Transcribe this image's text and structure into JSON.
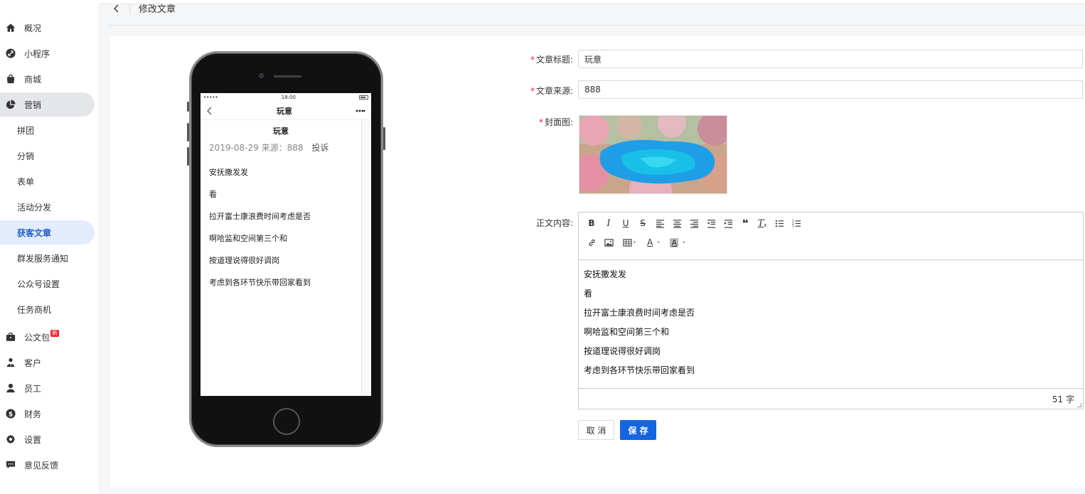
{
  "sidebar": {
    "items": [
      {
        "label": "概况",
        "icon": "home-icon"
      },
      {
        "label": "小程序",
        "icon": "link-icon"
      },
      {
        "label": "商城",
        "icon": "shopping-bag-icon"
      },
      {
        "label": "营销",
        "icon": "pie-chart-icon"
      },
      {
        "label": "拼团"
      },
      {
        "label": "分销"
      },
      {
        "label": "表单"
      },
      {
        "label": "活动分发"
      },
      {
        "label": "获客文章"
      },
      {
        "label": "群发服务通知"
      },
      {
        "label": "公众号设置"
      },
      {
        "label": "任务商机"
      },
      {
        "label": "公文包",
        "icon": "briefcase-icon",
        "badge": "新"
      },
      {
        "label": "客户",
        "icon": "customers-icon"
      },
      {
        "label": "员工",
        "icon": "user-icon"
      },
      {
        "label": "财务",
        "icon": "dollar-icon"
      },
      {
        "label": "设置",
        "icon": "gear-icon"
      },
      {
        "label": "意见反馈",
        "icon": "feedback-icon"
      }
    ],
    "active_item": "获客文章",
    "active_group": "营销"
  },
  "header": {
    "title": "修改文章"
  },
  "preview": {
    "status_time": "18:00",
    "status_signal": "•••••",
    "nav_title": "玩意",
    "article_title": "玩意",
    "date": "2019-08-29",
    "source_label": "来源：888",
    "report_label": "投诉",
    "paragraphs": [
      "安抚撒发发",
      "看",
      "拉开富士康浪费时间考虑是否",
      "啊哈监和空间第三个和",
      "按道理说得很好调岗",
      "考虑到各环节快乐带回家看到"
    ]
  },
  "form": {
    "title_label": "文章标题:",
    "title_value": "玩意",
    "source_label": "文章来源:",
    "source_value": "888",
    "cover_label": "封面图:",
    "content_label": "正文内容:",
    "required_mark": "*"
  },
  "editor": {
    "toolbar_row1": [
      {
        "name": "bold-icon",
        "glyph": "B"
      },
      {
        "name": "italic-icon",
        "glyph": "I"
      },
      {
        "name": "underline-icon",
        "glyph": "U"
      },
      {
        "name": "strikethrough-icon",
        "glyph": "S"
      },
      {
        "name": "align-left-icon",
        "glyph": ""
      },
      {
        "name": "align-center-icon",
        "glyph": ""
      },
      {
        "name": "align-right-icon",
        "glyph": ""
      },
      {
        "name": "outdent-icon",
        "glyph": ""
      },
      {
        "name": "indent-icon",
        "glyph": ""
      },
      {
        "name": "blockquote-icon",
        "glyph": "❝"
      },
      {
        "name": "clear-format-icon",
        "glyph": "T"
      },
      {
        "name": "bullet-list-icon",
        "glyph": ""
      },
      {
        "name": "numbered-list-icon",
        "glyph": ""
      }
    ],
    "toolbar_row2": [
      {
        "name": "link-icon"
      },
      {
        "name": "image-icon"
      },
      {
        "name": "table-icon"
      },
      {
        "name": "font-color-icon",
        "glyph": "A"
      },
      {
        "name": "background-color-icon",
        "glyph": "A"
      }
    ],
    "paragraphs": [
      "安抚撒发发",
      "看",
      "拉开富士康浪费时间考虑是否",
      "啊哈监和空间第三个和",
      "按道理说得很好调岗",
      "考虑到各环节快乐带回家看到"
    ],
    "word_count": "51 字"
  },
  "actions": {
    "cancel_label": "取 消",
    "save_label": "保 存"
  },
  "colors": {
    "primary": "#1565e0",
    "active_bg": "#e3ecfd",
    "required": "#f5222d"
  }
}
